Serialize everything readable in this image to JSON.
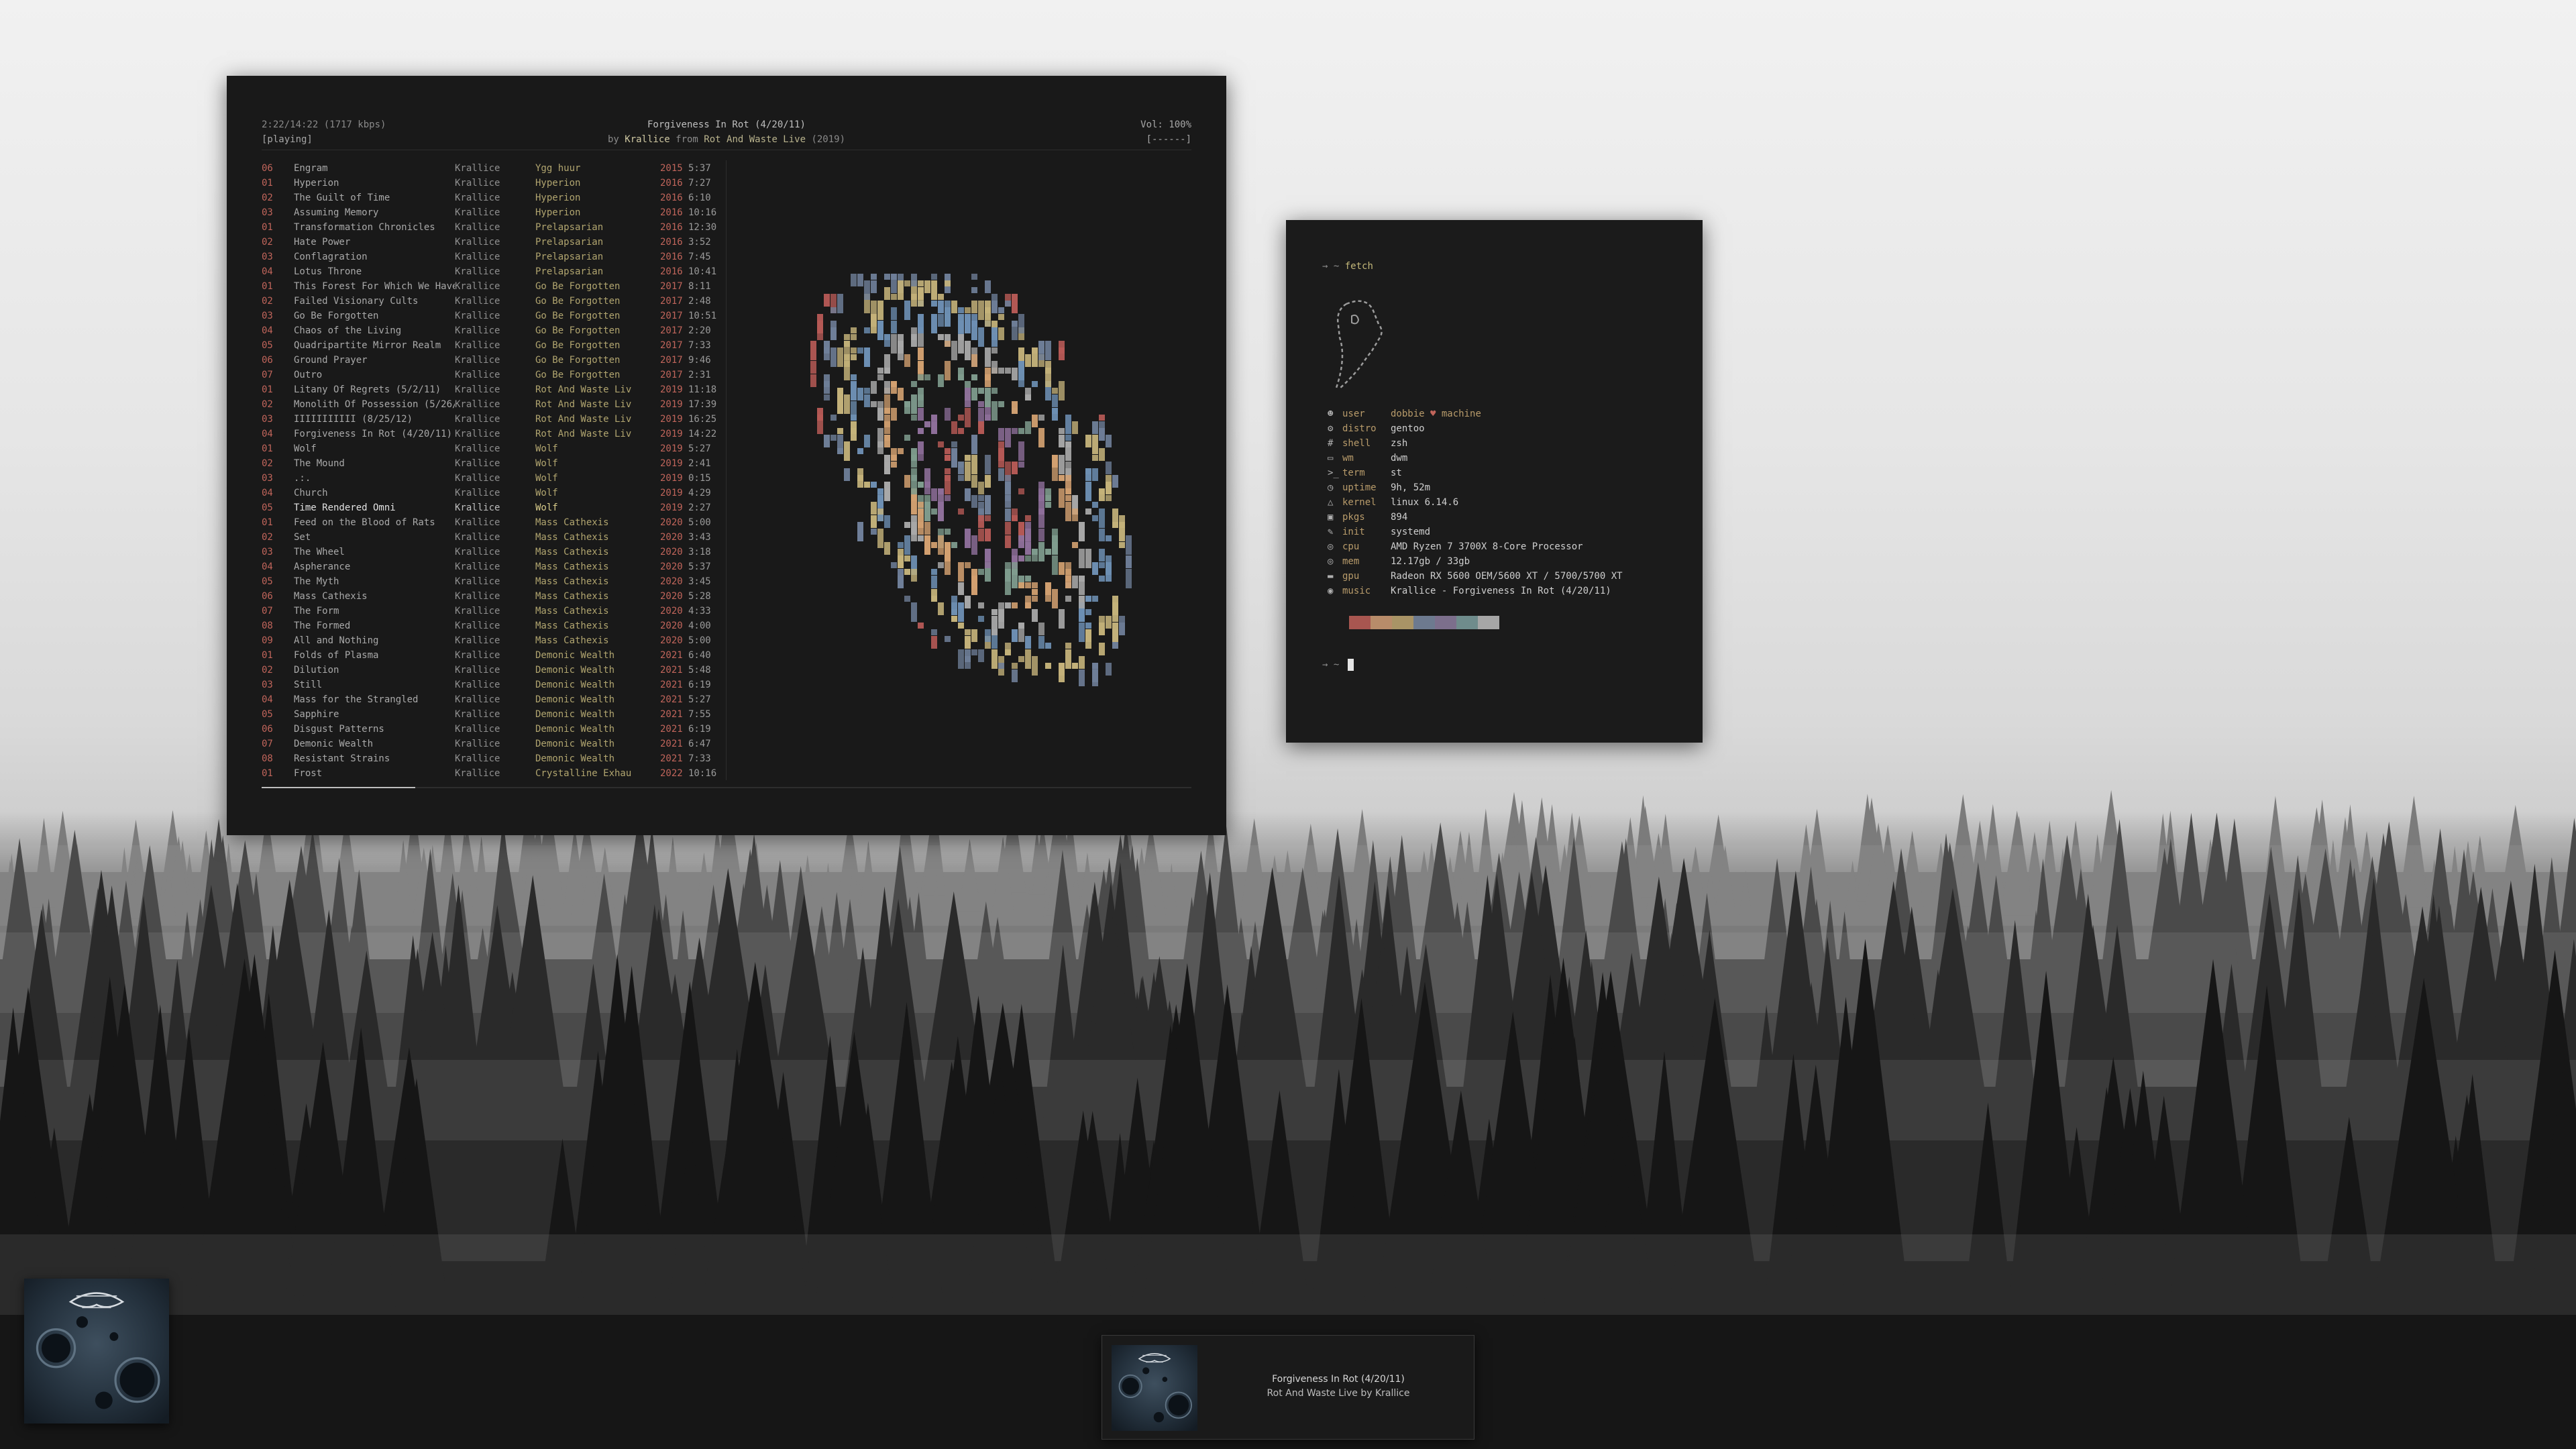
{
  "player": {
    "time": "2:22/14:22 (1717 kbps)",
    "state": "[playing]",
    "now_title": "Forgiveness In Rot (4/20/11)",
    "by_word": "by",
    "now_artist": "Krallice",
    "from_word": "from",
    "now_album": "Rot And Waste Live",
    "now_year": "(2019)",
    "volume": "Vol: 100%",
    "volume_bar": "[------]",
    "progress_fraction": 0.165,
    "current_index": 23,
    "tracks": [
      {
        "no": "06",
        "title": "Engram",
        "artist": "Krallice",
        "album": "Ygg huur",
        "year": "2015",
        "dur": "5:37"
      },
      {
        "no": "01",
        "title": "Hyperion",
        "artist": "Krallice",
        "album": "Hyperion",
        "year": "2016",
        "dur": "7:27"
      },
      {
        "no": "02",
        "title": "The Guilt of Time",
        "artist": "Krallice",
        "album": "Hyperion",
        "year": "2016",
        "dur": "6:10"
      },
      {
        "no": "03",
        "title": "Assuming Memory",
        "artist": "Krallice",
        "album": "Hyperion",
        "year": "2016",
        "dur": "10:16"
      },
      {
        "no": "01",
        "title": "Transformation Chronicles",
        "artist": "Krallice",
        "album": "Prelapsarian",
        "year": "2016",
        "dur": "12:30"
      },
      {
        "no": "02",
        "title": "Hate Power",
        "artist": "Krallice",
        "album": "Prelapsarian",
        "year": "2016",
        "dur": "3:52"
      },
      {
        "no": "03",
        "title": "Conflagration",
        "artist": "Krallice",
        "album": "Prelapsarian",
        "year": "2016",
        "dur": "7:45"
      },
      {
        "no": "04",
        "title": "Lotus Throne",
        "artist": "Krallice",
        "album": "Prelapsarian",
        "year": "2016",
        "dur": "10:41"
      },
      {
        "no": "01",
        "title": "This Forest For Which We Have",
        "artist": "Krallice",
        "album": "Go Be Forgotten",
        "year": "2017",
        "dur": "8:11"
      },
      {
        "no": "02",
        "title": "Failed Visionary Cults",
        "artist": "Krallice",
        "album": "Go Be Forgotten",
        "year": "2017",
        "dur": "2:48"
      },
      {
        "no": "03",
        "title": "Go Be Forgotten",
        "artist": "Krallice",
        "album": "Go Be Forgotten",
        "year": "2017",
        "dur": "10:51"
      },
      {
        "no": "04",
        "title": "Chaos of the Living",
        "artist": "Krallice",
        "album": "Go Be Forgotten",
        "year": "2017",
        "dur": "2:20"
      },
      {
        "no": "05",
        "title": "Quadripartite Mirror Realm",
        "artist": "Krallice",
        "album": "Go Be Forgotten",
        "year": "2017",
        "dur": "7:33"
      },
      {
        "no": "06",
        "title": "Ground Prayer",
        "artist": "Krallice",
        "album": "Go Be Forgotten",
        "year": "2017",
        "dur": "9:46"
      },
      {
        "no": "07",
        "title": "Outro",
        "artist": "Krallice",
        "album": "Go Be Forgotten",
        "year": "2017",
        "dur": "2:31"
      },
      {
        "no": "01",
        "title": "Litany Of Regrets (5/2/11)",
        "artist": "Krallice",
        "album": "Rot And Waste Liv",
        "year": "2019",
        "dur": "11:18"
      },
      {
        "no": "02",
        "title": "Monolith Of Possession (5/26/",
        "artist": "Krallice",
        "album": "Rot And Waste Liv",
        "year": "2019",
        "dur": "17:39"
      },
      {
        "no": "03",
        "title": "IIIIIIIIIII (8/25/12)",
        "artist": "Krallice",
        "album": "Rot And Waste Liv",
        "year": "2019",
        "dur": "16:25"
      },
      {
        "no": "04",
        "title": "Forgiveness In Rot (4/20/11)",
        "artist": "Krallice",
        "album": "Rot And Waste Liv",
        "year": "2019",
        "dur": "14:22"
      },
      {
        "no": "01",
        "title": "Wolf",
        "artist": "Krallice",
        "album": "Wolf",
        "year": "2019",
        "dur": "5:27"
      },
      {
        "no": "02",
        "title": "The Mound",
        "artist": "Krallice",
        "album": "Wolf",
        "year": "2019",
        "dur": "2:41"
      },
      {
        "no": "03",
        "title": ".:.",
        "artist": "Krallice",
        "album": "Wolf",
        "year": "2019",
        "dur": "0:15"
      },
      {
        "no": "04",
        "title": "Church",
        "artist": "Krallice",
        "album": "Wolf",
        "year": "2019",
        "dur": "4:29"
      },
      {
        "no": "05",
        "title": "Time Rendered Omni",
        "artist": "Krallice",
        "album": "Wolf",
        "year": "2019",
        "dur": "2:27"
      },
      {
        "no": "01",
        "title": "Feed on the Blood of Rats",
        "artist": "Krallice",
        "album": "Mass Cathexis",
        "year": "2020",
        "dur": "5:00"
      },
      {
        "no": "02",
        "title": "Set",
        "artist": "Krallice",
        "album": "Mass Cathexis",
        "year": "2020",
        "dur": "3:43"
      },
      {
        "no": "03",
        "title": "The Wheel",
        "artist": "Krallice",
        "album": "Mass Cathexis",
        "year": "2020",
        "dur": "3:18"
      },
      {
        "no": "04",
        "title": "Aspherance",
        "artist": "Krallice",
        "album": "Mass Cathexis",
        "year": "2020",
        "dur": "5:37"
      },
      {
        "no": "05",
        "title": "The Myth",
        "artist": "Krallice",
        "album": "Mass Cathexis",
        "year": "2020",
        "dur": "3:45"
      },
      {
        "no": "06",
        "title": "Mass Cathexis",
        "artist": "Krallice",
        "album": "Mass Cathexis",
        "year": "2020",
        "dur": "5:28"
      },
      {
        "no": "07",
        "title": "The Form",
        "artist": "Krallice",
        "album": "Mass Cathexis",
        "year": "2020",
        "dur": "4:33"
      },
      {
        "no": "08",
        "title": "The Formed",
        "artist": "Krallice",
        "album": "Mass Cathexis",
        "year": "2020",
        "dur": "4:00"
      },
      {
        "no": "09",
        "title": "All and Nothing",
        "artist": "Krallice",
        "album": "Mass Cathexis",
        "year": "2020",
        "dur": "5:00"
      },
      {
        "no": "01",
        "title": "Folds of Plasma",
        "artist": "Krallice",
        "album": "Demonic Wealth",
        "year": "2021",
        "dur": "6:40"
      },
      {
        "no": "02",
        "title": "Dilution",
        "artist": "Krallice",
        "album": "Demonic Wealth",
        "year": "2021",
        "dur": "5:48"
      },
      {
        "no": "03",
        "title": "Still",
        "artist": "Krallice",
        "album": "Demonic Wealth",
        "year": "2021",
        "dur": "6:19"
      },
      {
        "no": "04",
        "title": "Mass for the Strangled",
        "artist": "Krallice",
        "album": "Demonic Wealth",
        "year": "2021",
        "dur": "5:27"
      },
      {
        "no": "05",
        "title": "Sapphire",
        "artist": "Krallice",
        "album": "Demonic Wealth",
        "year": "2021",
        "dur": "7:55"
      },
      {
        "no": "06",
        "title": "Disgust Patterns",
        "artist": "Krallice",
        "album": "Demonic Wealth",
        "year": "2021",
        "dur": "6:19"
      },
      {
        "no": "07",
        "title": "Demonic Wealth",
        "artist": "Krallice",
        "album": "Demonic Wealth",
        "year": "2021",
        "dur": "6:47"
      },
      {
        "no": "08",
        "title": "Resistant Strains",
        "artist": "Krallice",
        "album": "Demonic Wealth",
        "year": "2021",
        "dur": "7:33"
      },
      {
        "no": "01",
        "title": "Frost",
        "artist": "Krallice",
        "album": "Crystalline Exhau",
        "year": "2022",
        "dur": "10:16"
      }
    ]
  },
  "terminal": {
    "prompt_arrow": "→",
    "prompt_dir": "~",
    "command": "fetch",
    "info": [
      {
        "icon": "user-icon",
        "glyph": "☻",
        "key": "user",
        "value": "dobbie",
        "value2": "machine"
      },
      {
        "icon": "distro-icon",
        "glyph": "⚙",
        "key": "distro",
        "value": "gentoo"
      },
      {
        "icon": "shell-icon",
        "glyph": "#",
        "key": "shell",
        "value": "zsh"
      },
      {
        "icon": "wm-icon",
        "glyph": "▭",
        "key": "wm",
        "value": "dwm"
      },
      {
        "icon": "term-icon",
        "glyph": ">_",
        "key": "term",
        "value": "st"
      },
      {
        "icon": "uptime-icon",
        "glyph": "◷",
        "key": "uptime",
        "value": "9h, 52m"
      },
      {
        "icon": "kernel-icon",
        "glyph": "△",
        "key": "kernel",
        "value": "linux 6.14.6"
      },
      {
        "icon": "pkgs-icon",
        "glyph": "▣",
        "key": "pkgs",
        "value": "894"
      },
      {
        "icon": "init-icon",
        "glyph": "✎",
        "key": "init",
        "value": "systemd"
      },
      {
        "icon": "cpu-icon",
        "glyph": "◎",
        "key": "cpu",
        "value": "AMD Ryzen 7 3700X 8-Core Processor"
      },
      {
        "icon": "mem-icon",
        "glyph": "◎",
        "key": "mem",
        "value": "12.17gb / 33gb"
      },
      {
        "icon": "gpu-icon",
        "glyph": "▬",
        "key": "gpu",
        "value": "Radeon RX 5600 OEM/5600 XT / 5700/5700 XT"
      },
      {
        "icon": "music-icon",
        "glyph": "◉",
        "key": "music",
        "value": "Krallice - Forgiveness In Rot (4/20/11)"
      }
    ],
    "swatches": [
      "#a85650",
      "#b88c6a",
      "#a99466",
      "#6d7a8f",
      "#7c6f8c",
      "#6f8c8c",
      "#a6a6a6"
    ]
  },
  "notification": {
    "line1": "Forgiveness In Rot (4/20/11)",
    "line2": "Rot And Waste Live by Krallice"
  },
  "colors": {
    "accent_red": "#c1655b",
    "album_yellow": "#b1a56f",
    "window_bg": "#191919"
  }
}
